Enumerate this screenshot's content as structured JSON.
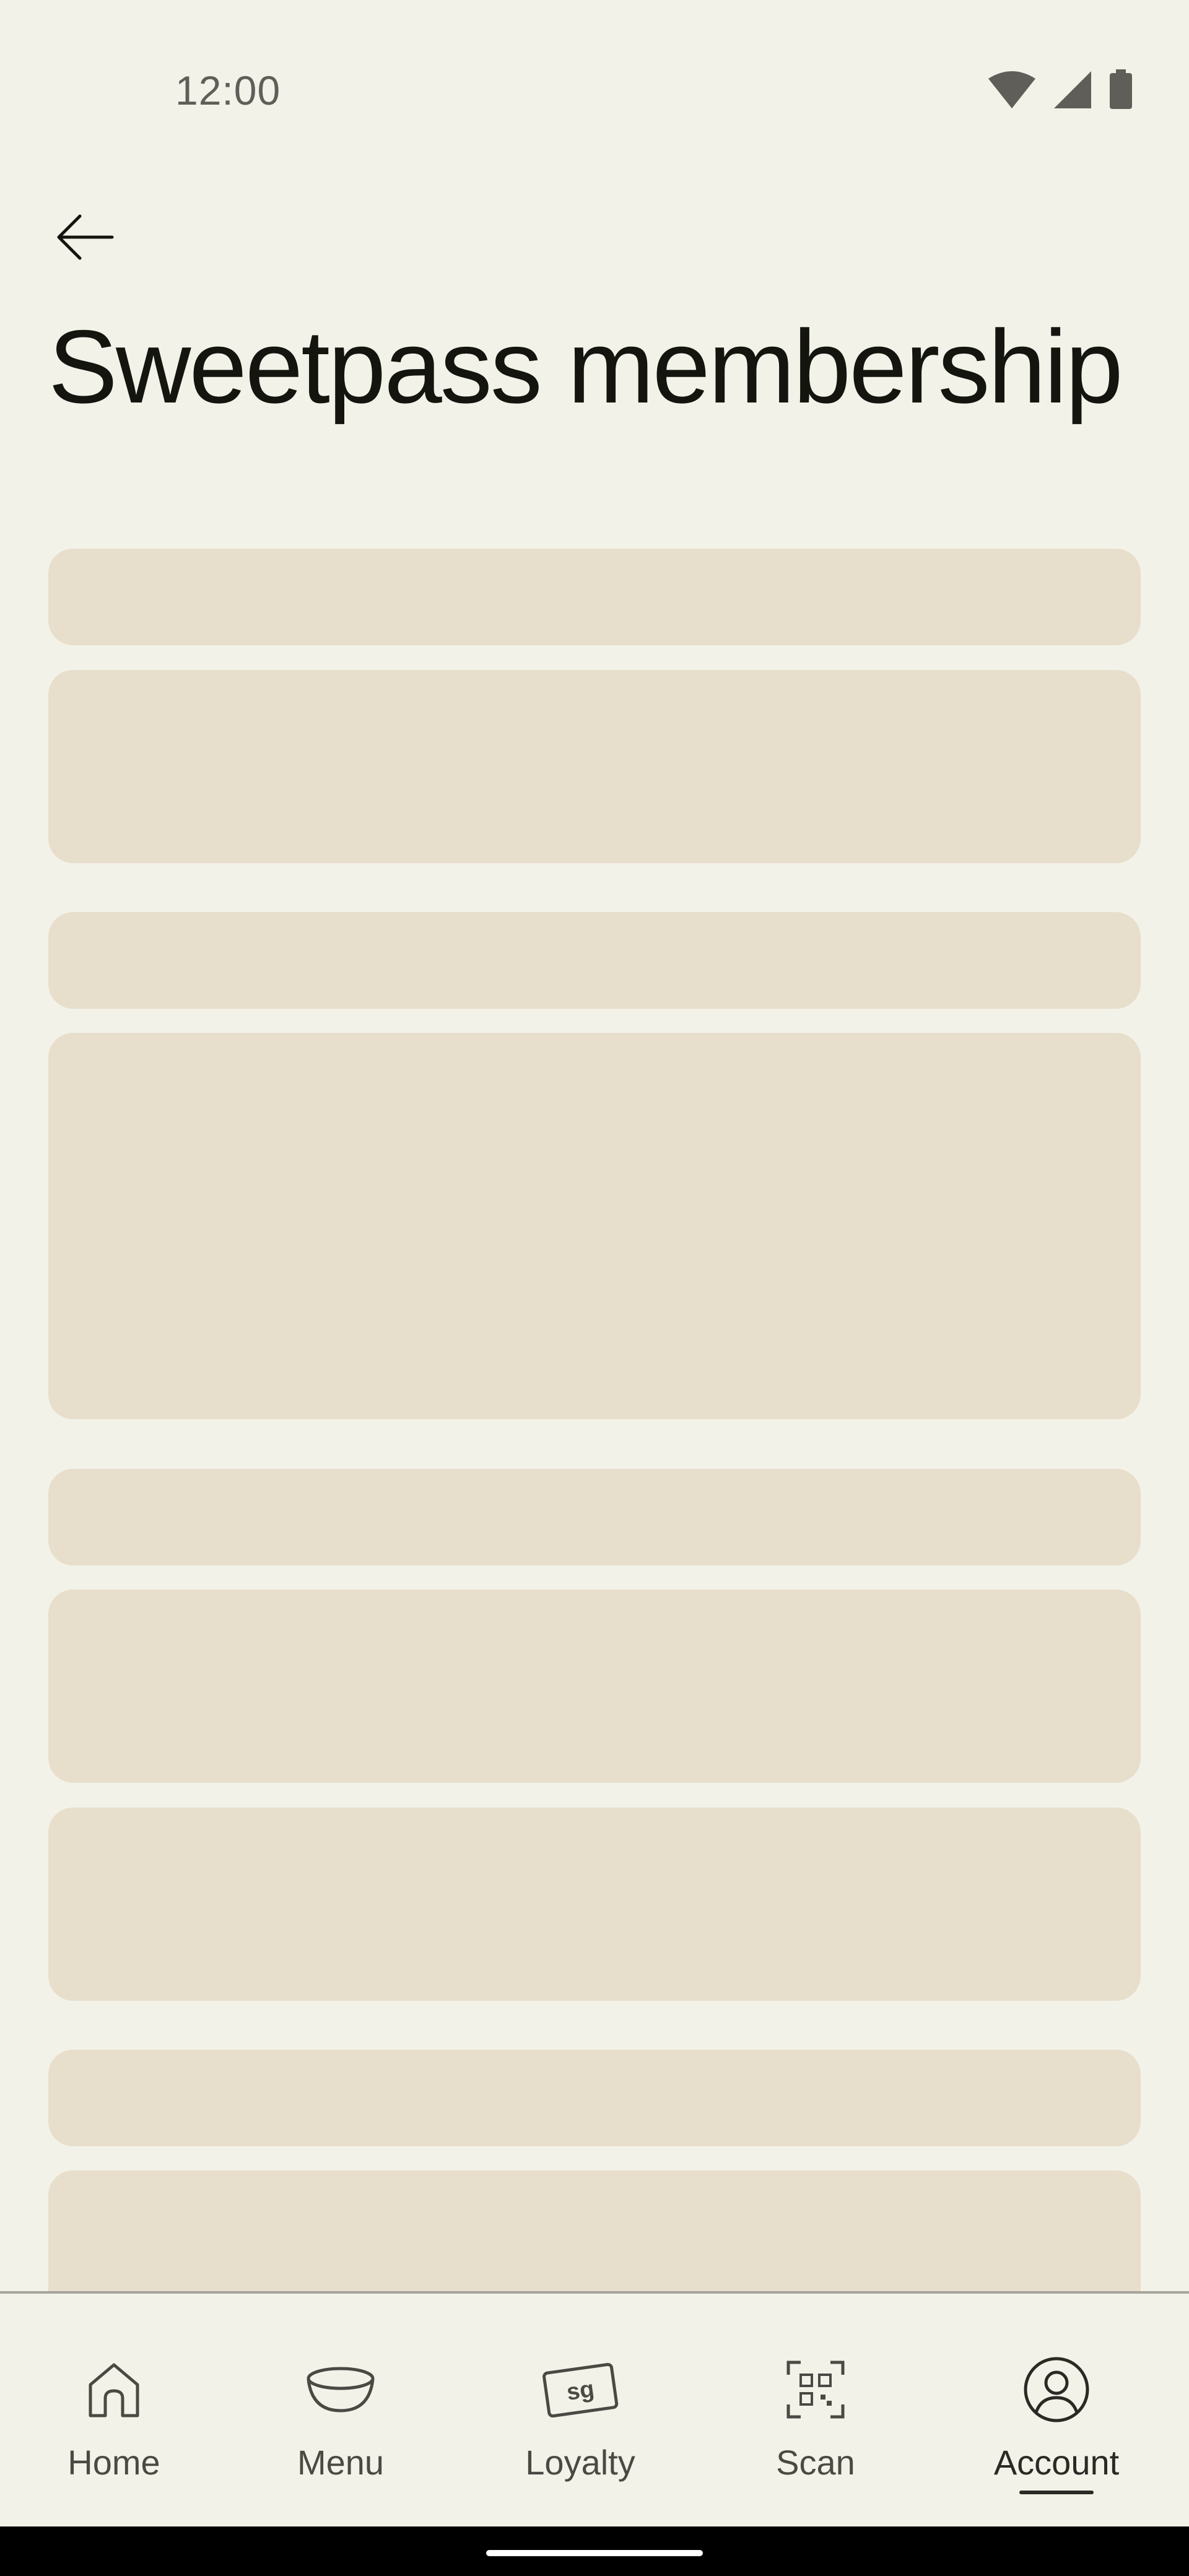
{
  "status_bar": {
    "time": "12:00",
    "icons": [
      "wifi-icon",
      "signal-icon",
      "battery-icon"
    ]
  },
  "header": {
    "back_icon": "arrow-left-icon",
    "title": "Sweetpass membership"
  },
  "content": {
    "state": "loading",
    "placeholder_color": "#e7decb"
  },
  "bottom_nav": {
    "items": [
      {
        "label": "Home",
        "icon": "home-icon"
      },
      {
        "label": "Menu",
        "icon": "bowl-icon"
      },
      {
        "label": "Loyalty",
        "icon": "sg-card-icon"
      },
      {
        "label": "Scan",
        "icon": "qr-scan-icon"
      },
      {
        "label": "Account",
        "icon": "account-icon",
        "selected": true
      }
    ]
  },
  "colors": {
    "background": "#f3f2e9",
    "text": "#14150f",
    "muted": "#4a4a44",
    "skeleton": "#e7decb"
  }
}
